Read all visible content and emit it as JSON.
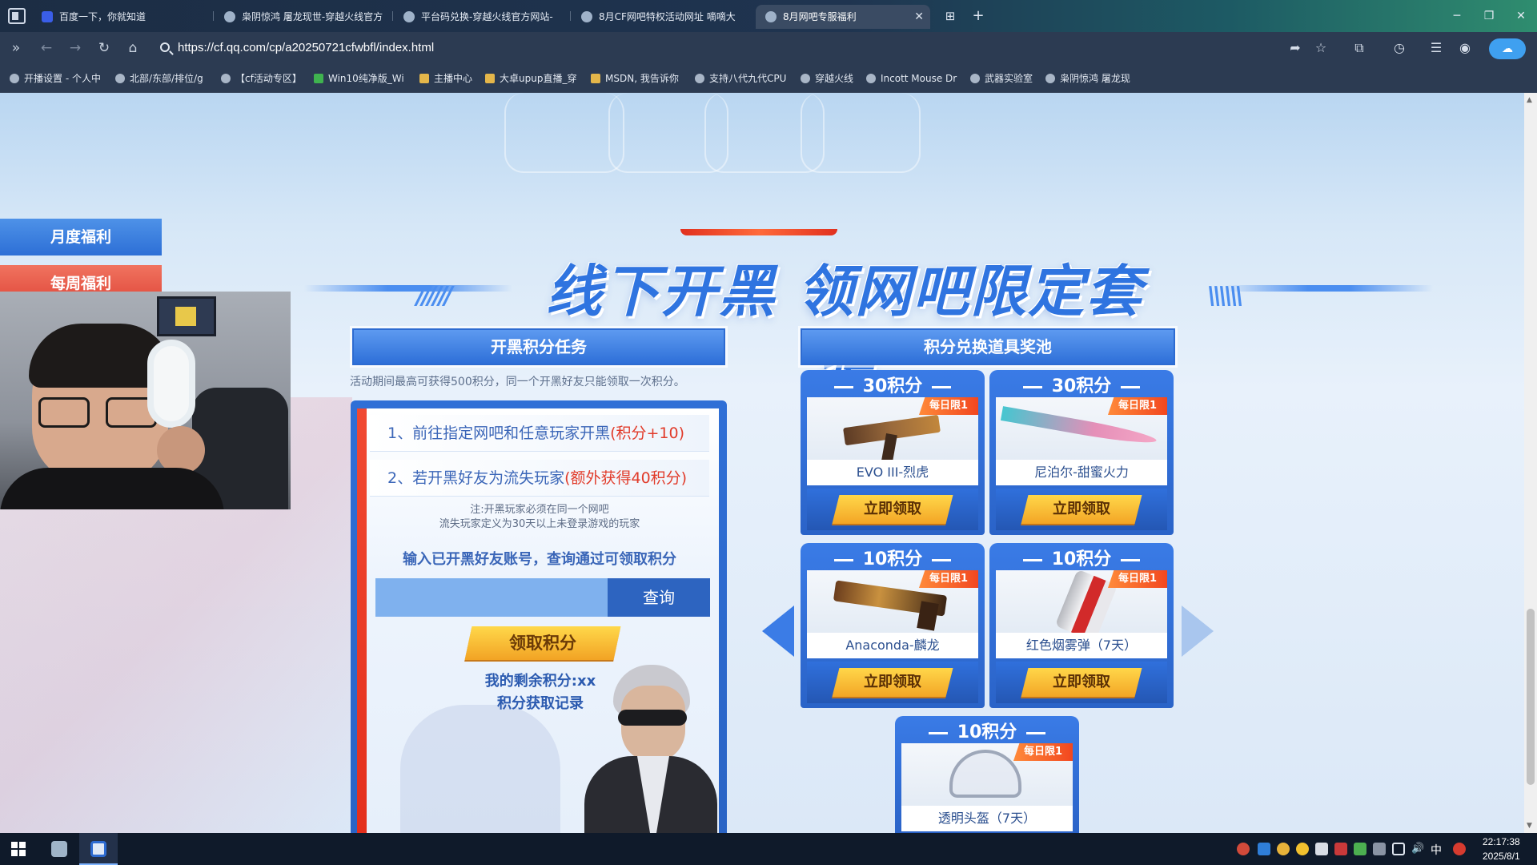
{
  "browser": {
    "tabs": [
      {
        "title": "百度一下，你就知道",
        "favicon": "baidu-icon"
      },
      {
        "title": "枭阴惊鸿 屠龙现世-穿越火线官方",
        "favicon": "cf-icon"
      },
      {
        "title": "平台码兑换-穿越火线官方网站-",
        "favicon": "cf-icon"
      },
      {
        "title": "8月CF网吧特权活动网址 嘀嘀大",
        "favicon": "cf-icon"
      },
      {
        "title": "8月网吧专服福利",
        "favicon": "cf-icon",
        "active": true
      }
    ],
    "tab_close": "✕",
    "new_tab": "+",
    "url": "https://cf.qq.com/cp/a20250721cfwbfl/index.html",
    "bookmarks": [
      "开播设置 - 个人中",
      "北部/东部/排位/g",
      "【cf活动专区】",
      "Win10纯净版_Wi",
      "主播中心",
      "大卓upup直播_穿",
      "MSDN, 我告诉你",
      "支持八代九代CPU",
      "穿越火线",
      "Incott Mouse Dr",
      "武器实验室",
      "枭阴惊鸿 屠龙现"
    ]
  },
  "side_nav": {
    "monthly": "月度福利",
    "weekly": "每周福利"
  },
  "hero": {
    "title": "线下开黑 领网吧限定套装"
  },
  "left_panel": {
    "header": "开黑积分任务",
    "notice": "活动期间最高可获得500积分，同一个开黑好友只能领取一次积分。",
    "task1_text": "1、前往指定网吧和任意玩家开黑",
    "task1_highlight": "(积分+10)",
    "task2_text": "2、若开黑好友为流失玩家",
    "task2_highlight": "(额外获得40积分)",
    "note_line1": "注:开黑玩家必须在同一个网吧",
    "note_line2": "流失玩家定义为30天以上未登录游戏的玩家",
    "query_title": "输入已开黑好友账号，查询通过可领取积分",
    "query_placeholder": "",
    "query_button": "查询",
    "claim_points_button": "领取积分",
    "remaining_points": "我的剩余积分:xx",
    "points_record": "积分获取记录"
  },
  "right_panel": {
    "header": "积分兑换道具奖池",
    "rewards": [
      {
        "points": "30积分",
        "name": "EVO III-烈虎",
        "badge": "每日限1",
        "claim": "立即领取"
      },
      {
        "points": "30积分",
        "name": "尼泊尔-甜蜜火力",
        "badge": "每日限1",
        "claim": "立即领取"
      },
      {
        "points": "10积分",
        "name": "Anaconda-麟龙",
        "badge": "每日限1",
        "claim": "立即领取"
      },
      {
        "points": "10积分",
        "name": "红色烟雾弹（7天）",
        "badge": "每日限1",
        "claim": "立即领取"
      },
      {
        "points": "10积分",
        "name": "透明头盔（7天）",
        "badge": "每日限1",
        "claim": "立即领取"
      }
    ]
  },
  "taskbar": {
    "time": "22:17:38",
    "date": "2025/8/1",
    "ime": "中"
  },
  "colors": {
    "accent_blue": "#2f74e0",
    "highlight_red": "#e13b2a",
    "button_gold": "#f2a324"
  }
}
